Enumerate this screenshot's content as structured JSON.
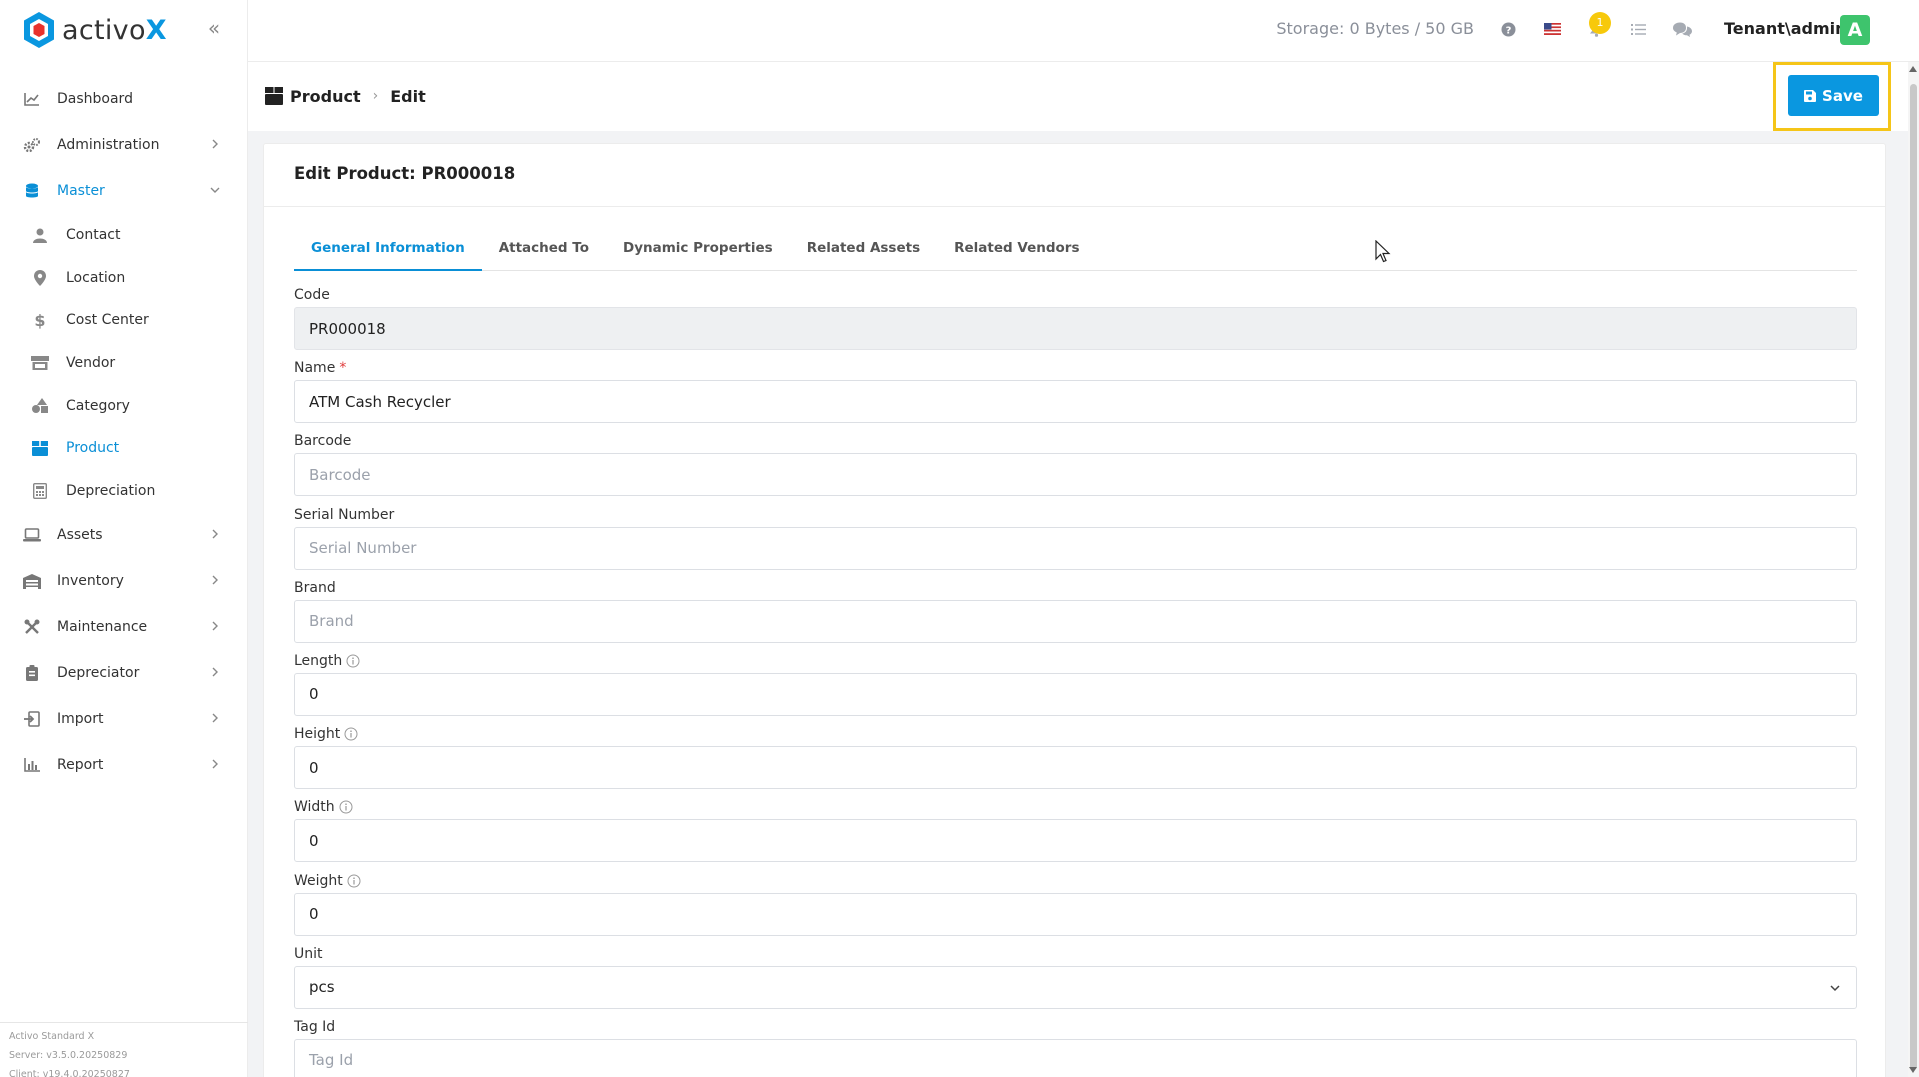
{
  "app": {
    "logo_text_main": "activo",
    "logo_text_accent": "X"
  },
  "sidebar": {
    "items": [
      {
        "label": "Dashboard",
        "icon": "chart-line-icon"
      },
      {
        "label": "Administration",
        "icon": "gears-icon"
      },
      {
        "label": "Master",
        "icon": "database-icon"
      },
      {
        "label": "Assets",
        "icon": "laptop-icon"
      },
      {
        "label": "Inventory",
        "icon": "warehouse-icon"
      },
      {
        "label": "Maintenance",
        "icon": "tools-icon"
      },
      {
        "label": "Depreciator",
        "icon": "calculator-tag-icon"
      },
      {
        "label": "Import",
        "icon": "import-icon"
      },
      {
        "label": "Report",
        "icon": "bar-chart-icon"
      }
    ],
    "master_sub": [
      {
        "label": "Contact",
        "icon": "user-icon"
      },
      {
        "label": "Location",
        "icon": "map-pin-icon"
      },
      {
        "label": "Cost Center",
        "icon": "dollar-icon"
      },
      {
        "label": "Vendor",
        "icon": "store-icon"
      },
      {
        "label": "Category",
        "icon": "shapes-icon"
      },
      {
        "label": "Product",
        "icon": "box-icon"
      },
      {
        "label": "Depreciation",
        "icon": "calculator-icon"
      }
    ],
    "footer": {
      "edition": "Activo Standard X",
      "server": "Server: v3.5.0.20250829",
      "client": "Client: v19.4.0.20250827"
    }
  },
  "header": {
    "storage": "Storage: 0 Bytes / 50 GB",
    "notification_count": "1",
    "user": "Tenant\\admin",
    "avatar_letter": "A"
  },
  "breadcrumb": {
    "section": "Product",
    "page": "Edit"
  },
  "toolbar": {
    "save_label": "Save"
  },
  "card": {
    "title": "Edit Product: PR000018"
  },
  "tabs": [
    {
      "label": "General Information",
      "active": true
    },
    {
      "label": "Attached To"
    },
    {
      "label": "Dynamic Properties"
    },
    {
      "label": "Related Assets"
    },
    {
      "label": "Related Vendors"
    }
  ],
  "form": {
    "code": {
      "label": "Code",
      "value": "PR000018"
    },
    "name": {
      "label": "Name",
      "required_mark": "*",
      "value": "ATM Cash Recycler"
    },
    "barcode": {
      "label": "Barcode",
      "placeholder": "Barcode"
    },
    "serial": {
      "label": "Serial Number",
      "placeholder": "Serial Number"
    },
    "brand": {
      "label": "Brand",
      "placeholder": "Brand"
    },
    "length": {
      "label": "Length",
      "value": "0"
    },
    "height": {
      "label": "Height",
      "value": "0"
    },
    "width": {
      "label": "Width",
      "value": "0"
    },
    "weight": {
      "label": "Weight",
      "value": "0"
    },
    "unit": {
      "label": "Unit",
      "value": "pcs"
    },
    "tagid": {
      "label": "Tag Id",
      "placeholder": "Tag Id"
    }
  },
  "colors": {
    "accent": "#0a97e0",
    "highlight": "#f5c518",
    "badge": "#f7c90b",
    "avatar": "#3ec46d"
  }
}
